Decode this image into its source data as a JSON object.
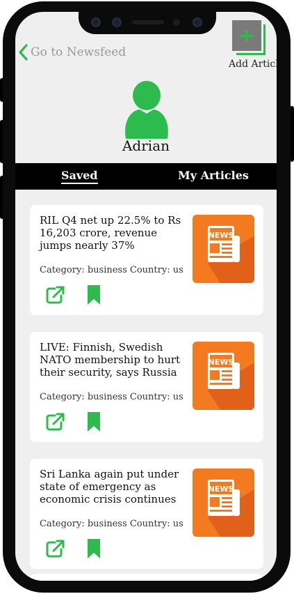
{
  "header": {
    "back_label": "Go to Newsfeed",
    "add_label": "Add Article",
    "add_symbol": "+"
  },
  "profile": {
    "name": "Adrian"
  },
  "tabs": [
    {
      "label": "Saved",
      "active": true
    },
    {
      "label": "My Articles",
      "active": false
    }
  ],
  "articles": [
    {
      "title": "RIL Q4 net up 22.5% to Rs 16,203 crore, revenue jumps nearly 37%",
      "meta": "Category: business Country: us",
      "thumb_icon": "news-icon"
    },
    {
      "title": "LIVE: Finnish, Swedish NATO membership to hurt their security, says Russia",
      "meta": "Category: business Country: us",
      "thumb_icon": "news-icon"
    },
    {
      "title": "Sri Lanka again put under state of emergency as economic crisis continues",
      "meta": "Category: business Country: us",
      "thumb_icon": "news-icon"
    }
  ],
  "colors": {
    "accent": "#2dbb4e",
    "thumb_orange": "#f47a20",
    "background": "#efefef",
    "tabbar": "#000000"
  }
}
